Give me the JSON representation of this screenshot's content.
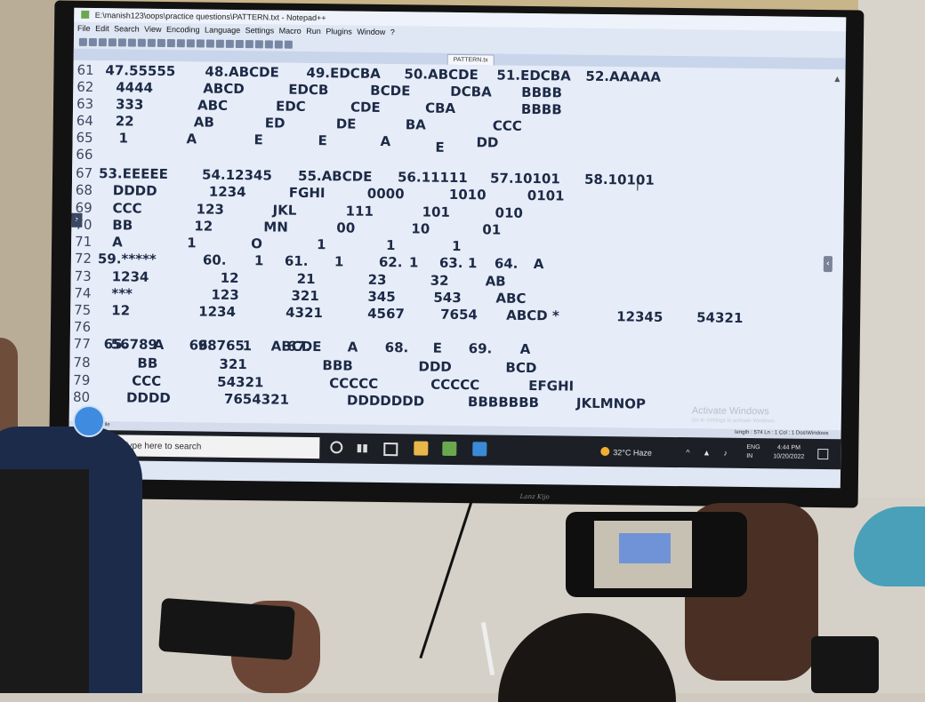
{
  "window": {
    "title": "E:\\manish123\\oops\\practice questions\\PATTERN.txt - Notepad++",
    "menu": [
      "File",
      "Edit",
      "Search",
      "View",
      "Encoding",
      "Language",
      "Settings",
      "Macro",
      "Run",
      "Plugins",
      "Window",
      "?"
    ],
    "active_tab": "PATTERN.tx"
  },
  "editor": {
    "line_numbers": [
      "61",
      "62",
      "63",
      "64",
      "65",
      "66",
      "67",
      "68",
      "69",
      "70",
      "71",
      "72",
      "73",
      "74",
      "75",
      "76",
      "77",
      "78",
      "79",
      "80"
    ],
    "rows": [
      [
        "47.55555",
        "48.ABCDE",
        "49.EDCBA",
        "50.ABCDE",
        "51.EDCBA",
        "52.AAAAA"
      ],
      [
        "4444",
        "ABCD",
        "EDCB",
        "BCDE",
        "DCBA",
        "BBBB"
      ],
      [
        "333",
        "ABC",
        "EDC",
        "CDE",
        "CBA",
        "BBBB"
      ],
      [
        "22",
        "AB",
        "ED",
        "DE",
        "BA",
        "CCC"
      ],
      [
        "1",
        "A",
        "E",
        "E",
        "A",
        "DD"
      ],
      [
        "E"
      ],
      [
        "53.EEEEE",
        "54.12345",
        "55.ABCDE",
        "56.11111",
        "57.10101",
        "58.10101"
      ],
      [
        "DDDD",
        "1234",
        "FGHI",
        "0000",
        "1010",
        "0101"
      ],
      [
        "CCC",
        "123",
        "JKL",
        "111",
        "101",
        "010"
      ],
      [
        "BB",
        "12",
        "MN",
        "00",
        "10",
        "01"
      ],
      [
        "A",
        "1",
        "O",
        "1",
        "1",
        "1"
      ],
      [
        "59.*****",
        "60.",
        "1",
        "61.",
        "1",
        "62.",
        "1",
        "63.",
        "1",
        "64.",
        "A"
      ],
      [
        "1234",
        "12",
        "21",
        "23",
        "32",
        "AB"
      ],
      [
        "***",
        "123",
        "321",
        "345",
        "543",
        "ABC"
      ],
      [
        "12",
        "1234",
        "4321",
        "4567",
        "7654",
        "ABCD *",
        "12345",
        "54321"
      ],
      [
        "56789",
        "98765",
        "ABCDE"
      ],
      [
        "65.",
        "A",
        "66.",
        "1",
        "67.",
        "A",
        "68.",
        "E",
        "69.",
        "A"
      ],
      [
        "BB",
        "321",
        "BBB",
        "DDD",
        "BCD"
      ],
      [
        "CCC",
        "54321",
        "CCCCC",
        "CCCCC",
        "EFGHI"
      ],
      [
        "DDDD",
        "7654321",
        "DDDDDDD",
        "BBBBBBB",
        "JKLMNOP"
      ]
    ]
  },
  "statusbar": {
    "left": "Normal text file",
    "right": "length : 574   Ln : 1   Col : 1   Dos\\Windows"
  },
  "watermark": {
    "title": "Activate Windows",
    "subtitle": "Go to Settings to activate Windows."
  },
  "taskbar": {
    "search_placeholder": "Type here to search",
    "weather": "32°C  Haze",
    "lang_top": "ENG",
    "lang_bottom": "IN",
    "time": "4:44 PM",
    "date": "10/20/2022"
  },
  "tv_brand": "Lanz Kijo"
}
